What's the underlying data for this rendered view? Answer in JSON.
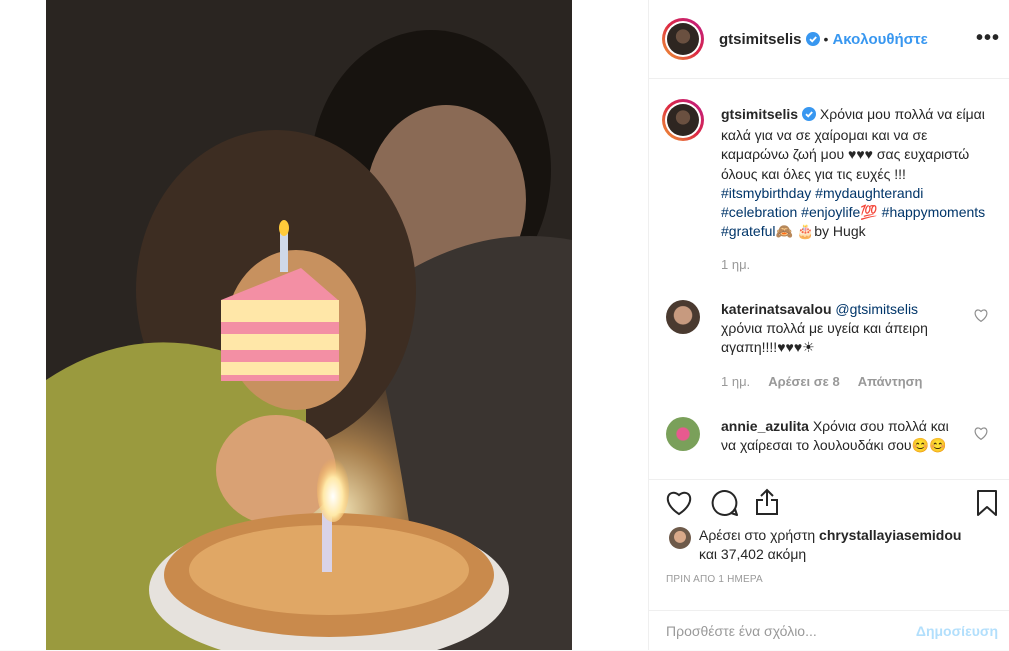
{
  "post": {
    "username": "gtsimitselis",
    "follow_label": "Ακολουθήστε",
    "more_label": "•••"
  },
  "caption": {
    "username": "gtsimitselis",
    "text": "Χρόνια μου πολλά να είμαι καλά για να σε χαίρομαι και να σε καμαρώνω ζωή μου ♥♥♥ σας ευχαριστώ όλους και όλες για τις ευχές !!! ",
    "hashtags": [
      "#itsmybirthday",
      "#mydaughterandi",
      "#celebration",
      "#enjoylife💯",
      "#happymoments",
      "#grateful🙈"
    ],
    "suffix": " 🎂by Hugk",
    "time": "1 ημ."
  },
  "comments": [
    {
      "username": "katerinatsavalou",
      "mention": "@gtsimitselis",
      "text": "χρόνια πολλά με υγεία και άπειρη αγαπη!!!!♥♥♥☀",
      "time": "1 ημ.",
      "likes": "Αρέσει σε 8",
      "reply_label": "Απάντηση"
    },
    {
      "username": "annie_azulita",
      "text": "Χρόνια σου πολλά και να χαίρεσαι το λουλουδάκι σου😊😊"
    }
  ],
  "likes": {
    "prefix": "Αρέσει στο χρήστη",
    "user": "chrystallayiasemidou",
    "rest": "και 37,402 ακόμη"
  },
  "timestamp": "ΠΡΙΝ ΑΠΟ 1 ΗΜΕΡΑ",
  "add_comment": {
    "placeholder": "Προσθέστε ένα σχόλιο...",
    "post_label": "Δημοσίευση"
  }
}
